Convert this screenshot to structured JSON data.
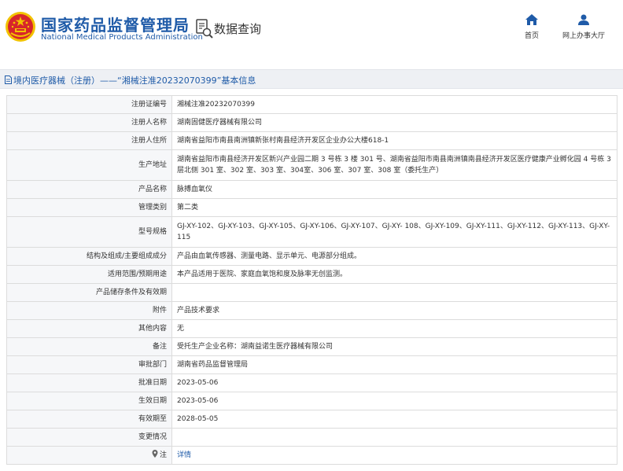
{
  "header": {
    "brand_cn": "国家药品监督管理局",
    "brand_en": "National Medical Products Administration",
    "query_title": "数据查询",
    "nav": [
      {
        "label": "首页",
        "icon": "home-icon"
      },
      {
        "label": "网上办事大厅",
        "icon": "user-icon"
      }
    ],
    "colors": {
      "brand": "#1f5ba8",
      "emblem_red": "#d7262b",
      "emblem_gold": "#f2c200"
    }
  },
  "title_bar": {
    "text": "境内医疗器械（注册）——“湘械注准20232070399”基本信息"
  },
  "rows": [
    {
      "label": "注册证编号",
      "value": "湘械注准20232070399"
    },
    {
      "label": "注册人名称",
      "value": "湖南固健医疗器械有限公司"
    },
    {
      "label": "注册人住所",
      "value": "湖南省益阳市南县南洲镇新张村南县经济开发区企业办公大楼618-1"
    },
    {
      "label": "生产地址",
      "value": "湖南省益阳市南县经济开发区新兴产业园二期 3 号栋 3 楼 301 号、湖南省益阳市南县南洲镇南县经济开发区医疗健康产业孵化园 4 号栋 3 层北侧 301 室、302 室、303 室、304室、306 室、307 室、308 室（委托生产）"
    },
    {
      "label": "产品名称",
      "value": "脉搏血氧仪"
    },
    {
      "label": "管理类别",
      "value": "第二类"
    },
    {
      "label": "型号规格",
      "value": "GJ-XY-102、GJ-XY-103、GJ-XY-105、GJ-XY-106、GJ-XY-107、GJ-XY- 108、GJ-XY-109、GJ-XY-111、GJ-XY-112、GJ-XY-113、GJ-XY-115"
    },
    {
      "label": "结构及组成/主要组成成分",
      "value": "产品由血氧传感器、测量电路、显示单元、电源部分组成。"
    },
    {
      "label": "适用范围/预期用途",
      "value": "本产品适用于医院、家庭血氧饱和度及脉率无创监测。"
    },
    {
      "label": "产品储存条件及有效期",
      "value": ""
    },
    {
      "label": "附件",
      "value": "产品技术要求"
    },
    {
      "label": "其他内容",
      "value": "无"
    },
    {
      "label": "备注",
      "value": "受托生产企业名称：湖南益诺生医疗器械有限公司"
    },
    {
      "label": "审批部门",
      "value": "湖南省药品监督管理局"
    },
    {
      "label": "批准日期",
      "value": "2023-05-06"
    },
    {
      "label": "生效日期",
      "value": "2023-05-06"
    },
    {
      "label": "有效期至",
      "value": "2028-05-05"
    },
    {
      "label": "变更情况",
      "value": ""
    },
    {
      "label": "注",
      "value": "详情",
      "icon": "pin-icon",
      "link": true
    }
  ]
}
